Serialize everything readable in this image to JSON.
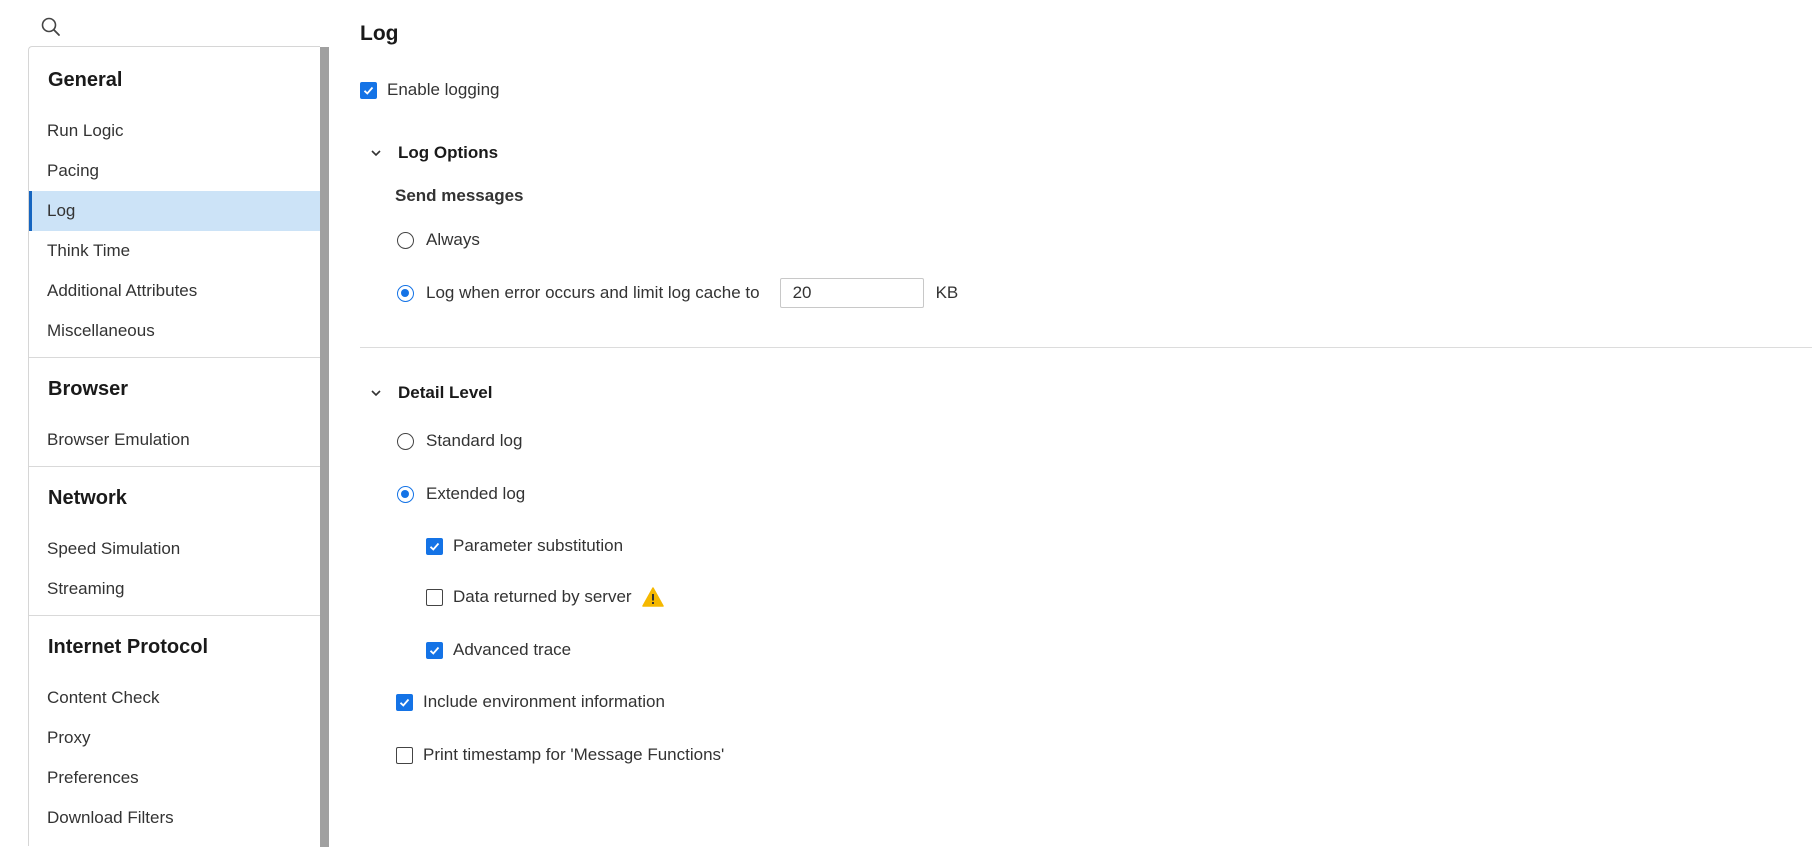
{
  "sidebar": {
    "groups": [
      {
        "heading": "General",
        "items": [
          {
            "label": "Run Logic"
          },
          {
            "label": "Pacing"
          },
          {
            "label": "Log"
          },
          {
            "label": "Think Time"
          },
          {
            "label": "Additional Attributes"
          },
          {
            "label": "Miscellaneous"
          }
        ]
      },
      {
        "heading": "Browser",
        "items": [
          {
            "label": "Browser Emulation"
          }
        ]
      },
      {
        "heading": "Network",
        "items": [
          {
            "label": "Speed Simulation"
          },
          {
            "label": "Streaming"
          }
        ]
      },
      {
        "heading": "Internet Protocol",
        "items": [
          {
            "label": "Content Check"
          },
          {
            "label": "Proxy"
          },
          {
            "label": "Preferences"
          },
          {
            "label": "Download Filters"
          }
        ]
      }
    ],
    "active_item": "Log"
  },
  "main": {
    "title": "Log",
    "enable_logging": {
      "label": "Enable logging",
      "checked": true
    },
    "log_options": {
      "title": "Log Options",
      "send_messages_heading": "Send messages",
      "always": {
        "label": "Always",
        "selected": false
      },
      "on_error": {
        "label": "Log when error occurs and limit log cache to",
        "selected": true
      },
      "cache_size": "20",
      "cache_unit": "KB"
    },
    "detail_level": {
      "title": "Detail Level",
      "standard": {
        "label": "Standard log",
        "selected": false
      },
      "extended": {
        "label": "Extended log",
        "selected": true
      },
      "parameter_substitution": {
        "label": "Parameter substitution",
        "checked": true
      },
      "data_returned": {
        "label": "Data returned by server",
        "checked": false
      },
      "advanced_trace": {
        "label": "Advanced trace",
        "checked": true
      },
      "include_env": {
        "label": "Include environment information",
        "checked": true
      },
      "print_timestamp": {
        "label": "Print timestamp for 'Message Functions'",
        "checked": false
      }
    }
  },
  "colors": {
    "accent": "#1473e6",
    "active_bg": "#cce3f7",
    "warning": "#f5b800"
  },
  "icons": {
    "search": "search-icon",
    "chevron": "chevron-down-icon",
    "warning": "warning-icon",
    "check": "check-icon"
  }
}
